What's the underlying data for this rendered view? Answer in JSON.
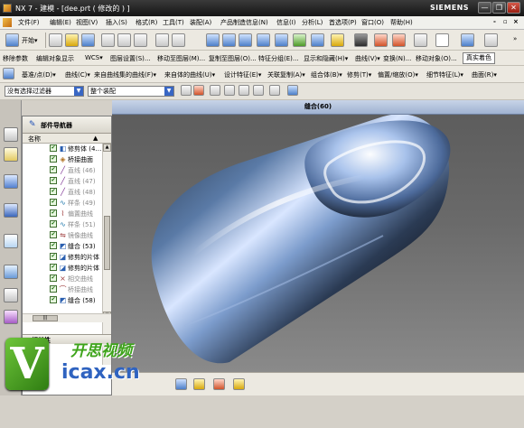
{
  "window": {
    "title": "NX 7 - 建模 - [dee.prt  ( 修改的 ) ]",
    "brand": "SIEMENS",
    "min_glyph": "—",
    "max_glyph": "❐",
    "close_glyph": "✕"
  },
  "menu": {
    "items": [
      {
        "label": "文件(F)"
      },
      {
        "label": "编辑(E)"
      },
      {
        "label": "视图(V)"
      },
      {
        "label": "插入(S)"
      },
      {
        "label": "格式(R)"
      },
      {
        "label": "工具(T)"
      },
      {
        "label": "装配(A)"
      },
      {
        "label": "产品制造信息(N)"
      },
      {
        "label": "信息(I)"
      },
      {
        "label": "分析(L)"
      },
      {
        "label": "首选项(P)"
      },
      {
        "label": "窗口(O)"
      },
      {
        "label": "帮助(H)"
      }
    ],
    "mdi_min": "-",
    "mdi_max": "▫",
    "mdi_close": "×"
  },
  "toolbar1": {
    "start_label": "开始▾",
    "view_label": "真实着色",
    "overflow": "»"
  },
  "toolbar2": {
    "items": [
      {
        "label": "移除参数"
      },
      {
        "label": "编辑对象显示"
      },
      {
        "label": "WCS▾"
      },
      {
        "label": "图层设置(S)..."
      },
      {
        "label": "移动至图层(M)..."
      },
      {
        "label": "复制至图层(O)..."
      },
      {
        "label": "特征分组(E)..."
      },
      {
        "label": "显示和隐藏(H)▾"
      },
      {
        "label": "曲线(V)▾"
      },
      {
        "label": "变换(N)..."
      },
      {
        "label": "移动对象(O)..."
      }
    ]
  },
  "toolbar3": {
    "items": [
      {
        "label": "基准/点(D)▾"
      },
      {
        "label": "曲线(C)▾"
      },
      {
        "label": "来自曲线集的曲线(F)▾"
      },
      {
        "label": "来自体的曲线(U)▾"
      },
      {
        "label": "设计特征(E)▾"
      },
      {
        "label": "关联复制(A)▾"
      },
      {
        "label": "组合体(B)▾"
      },
      {
        "label": "修剪(T)▾"
      },
      {
        "label": "偏置/缩放(O)▾"
      },
      {
        "label": "细节特征(L)▾"
      },
      {
        "label": "曲面(R)▾"
      }
    ]
  },
  "toolbar4": {
    "filter_value": "没有选择过滤器",
    "scope_value": "整个装配"
  },
  "navigator": {
    "title": "部件导航器",
    "col_name": "名称",
    "col_extra": "▲",
    "items": [
      {
        "label": "修剪体 (4…",
        "icon": "trim-body-icon",
        "glyph": "◧",
        "color": "#2a5fb0",
        "muted": false
      },
      {
        "label": "桥接曲面",
        "icon": "bridge-surface-icon",
        "glyph": "◈",
        "color": "#b07020",
        "muted": false
      },
      {
        "label": "直线 (46)",
        "icon": "line-icon",
        "glyph": "╱",
        "color": "#7a2d90",
        "muted": true
      },
      {
        "label": "直线 (47)",
        "icon": "line-icon",
        "glyph": "╱",
        "color": "#7a2d90",
        "muted": true
      },
      {
        "label": "直线 (48)",
        "icon": "line-icon",
        "glyph": "╱",
        "color": "#7a2d90",
        "muted": true
      },
      {
        "label": "样条 (49)",
        "icon": "spline-icon",
        "glyph": "∿",
        "color": "#2a7fb0",
        "muted": true
      },
      {
        "label": "偏置曲线",
        "icon": "offset-curve-icon",
        "glyph": "⌇",
        "color": "#a04040",
        "muted": true
      },
      {
        "label": "样条 (51)",
        "icon": "spline-icon",
        "glyph": "∿",
        "color": "#2a7fb0",
        "muted": true
      },
      {
        "label": "镜像曲线",
        "icon": "mirror-curve-icon",
        "glyph": "⇋",
        "color": "#a04040",
        "muted": true
      },
      {
        "label": "缝合 (53)",
        "icon": "sew-icon",
        "glyph": "◩",
        "color": "#2a5fb0",
        "muted": false
      },
      {
        "label": "修剪的片体",
        "icon": "trimmed-sheet-icon",
        "glyph": "◪",
        "color": "#2a5fb0",
        "muted": false
      },
      {
        "label": "修剪的片体",
        "icon": "trimmed-sheet-icon",
        "glyph": "◪",
        "color": "#2a5fb0",
        "muted": false
      },
      {
        "label": "相交曲线",
        "icon": "intersect-curve-icon",
        "glyph": "⨯",
        "color": "#a04040",
        "muted": true
      },
      {
        "label": "桥接曲线",
        "icon": "bridge-curve-icon",
        "glyph": "⌒",
        "color": "#a04040",
        "muted": true
      },
      {
        "label": "缝合 (58)",
        "icon": "sew-icon",
        "glyph": "◩",
        "color": "#2a5fb0",
        "muted": false
      }
    ],
    "related_title": "相关性"
  },
  "viewport": {
    "title": "缝合(60)"
  },
  "watermark": {
    "logo_letter": "V",
    "title": "开思视频",
    "site": "icax.cn"
  }
}
